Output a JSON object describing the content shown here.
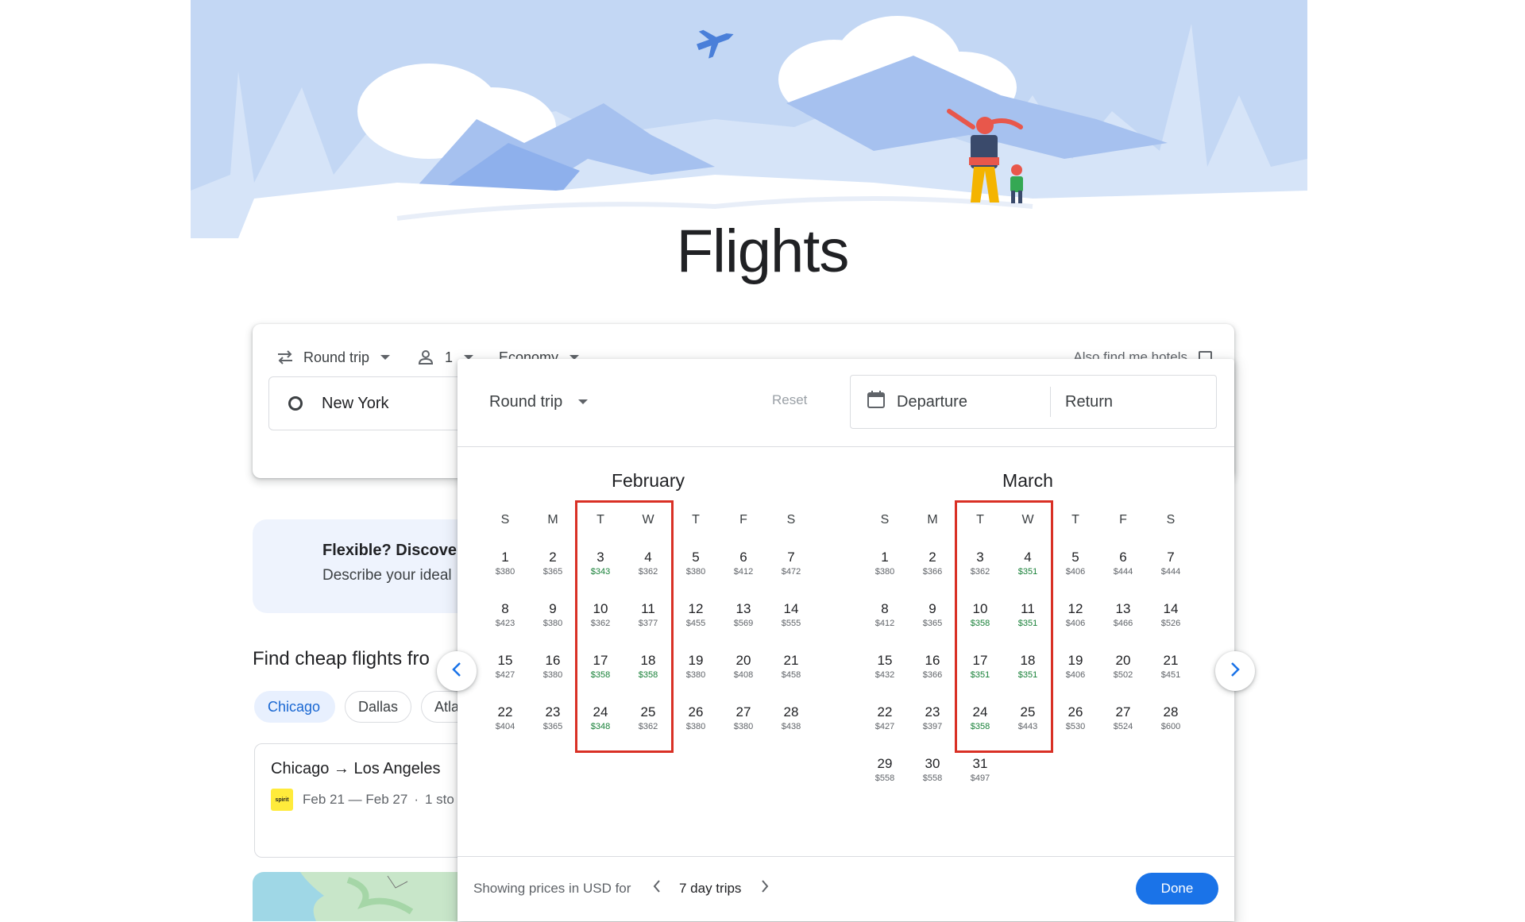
{
  "page": {
    "title": "Flights"
  },
  "search": {
    "trip_type": "Round trip",
    "passengers": "1",
    "cabin": "Economy",
    "hotels_label": "Also find me hotels",
    "origin": "New York"
  },
  "flexible": {
    "title": "Flexible? Discover",
    "subtitle": "Describe your ideal"
  },
  "cheap": {
    "heading": "Find cheap flights fro",
    "chips": [
      "Chicago",
      "Dallas",
      "Atla"
    ],
    "route": {
      "title": "Chicago → Los Angeles",
      "dates": "Feb 21 — Feb 27",
      "stops": "1 sto",
      "airline_logo": "spirit"
    }
  },
  "calendar": {
    "trip_type": "Round trip",
    "reset_label": "Reset",
    "departure_label": "Departure",
    "return_label": "Return",
    "weekdays": [
      "S",
      "M",
      "T",
      "W",
      "T",
      "F",
      "S"
    ],
    "months": [
      {
        "name": "February",
        "start_weekday": 0,
        "days": [
          {
            "d": "1",
            "p": "$380",
            "low": false
          },
          {
            "d": "2",
            "p": "$365",
            "low": false
          },
          {
            "d": "3",
            "p": "$343",
            "low": true
          },
          {
            "d": "4",
            "p": "$362",
            "low": false
          },
          {
            "d": "5",
            "p": "$380",
            "low": false
          },
          {
            "d": "6",
            "p": "$412",
            "low": false
          },
          {
            "d": "7",
            "p": "$472",
            "low": false
          },
          {
            "d": "8",
            "p": "$423",
            "low": false
          },
          {
            "d": "9",
            "p": "$380",
            "low": false
          },
          {
            "d": "10",
            "p": "$362",
            "low": false
          },
          {
            "d": "11",
            "p": "$377",
            "low": false
          },
          {
            "d": "12",
            "p": "$455",
            "low": false
          },
          {
            "d": "13",
            "p": "$569",
            "low": false
          },
          {
            "d": "14",
            "p": "$555",
            "low": false
          },
          {
            "d": "15",
            "p": "$427",
            "low": false
          },
          {
            "d": "16",
            "p": "$380",
            "low": false
          },
          {
            "d": "17",
            "p": "$358",
            "low": true
          },
          {
            "d": "18",
            "p": "$358",
            "low": true
          },
          {
            "d": "19",
            "p": "$380",
            "low": false
          },
          {
            "d": "20",
            "p": "$408",
            "low": false
          },
          {
            "d": "21",
            "p": "$458",
            "low": false
          },
          {
            "d": "22",
            "p": "$404",
            "low": false
          },
          {
            "d": "23",
            "p": "$365",
            "low": false
          },
          {
            "d": "24",
            "p": "$348",
            "low": true
          },
          {
            "d": "25",
            "p": "$362",
            "low": false
          },
          {
            "d": "26",
            "p": "$380",
            "low": false
          },
          {
            "d": "27",
            "p": "$380",
            "low": false
          },
          {
            "d": "28",
            "p": "$438",
            "low": false
          }
        ]
      },
      {
        "name": "March",
        "start_weekday": 0,
        "days": [
          {
            "d": "1",
            "p": "$380",
            "low": false
          },
          {
            "d": "2",
            "p": "$366",
            "low": false
          },
          {
            "d": "3",
            "p": "$362",
            "low": false
          },
          {
            "d": "4",
            "p": "$351",
            "low": true
          },
          {
            "d": "5",
            "p": "$406",
            "low": false
          },
          {
            "d": "6",
            "p": "$444",
            "low": false
          },
          {
            "d": "7",
            "p": "$444",
            "low": false
          },
          {
            "d": "8",
            "p": "$412",
            "low": false
          },
          {
            "d": "9",
            "p": "$365",
            "low": false
          },
          {
            "d": "10",
            "p": "$358",
            "low": true
          },
          {
            "d": "11",
            "p": "$351",
            "low": true
          },
          {
            "d": "12",
            "p": "$406",
            "low": false
          },
          {
            "d": "13",
            "p": "$466",
            "low": false
          },
          {
            "d": "14",
            "p": "$526",
            "low": false
          },
          {
            "d": "15",
            "p": "$432",
            "low": false
          },
          {
            "d": "16",
            "p": "$366",
            "low": false
          },
          {
            "d": "17",
            "p": "$351",
            "low": true
          },
          {
            "d": "18",
            "p": "$351",
            "low": true
          },
          {
            "d": "19",
            "p": "$406",
            "low": false
          },
          {
            "d": "20",
            "p": "$502",
            "low": false
          },
          {
            "d": "21",
            "p": "$451",
            "low": false
          },
          {
            "d": "22",
            "p": "$427",
            "low": false
          },
          {
            "d": "23",
            "p": "$397",
            "low": false
          },
          {
            "d": "24",
            "p": "$358",
            "low": true
          },
          {
            "d": "25",
            "p": "$443",
            "low": false
          },
          {
            "d": "26",
            "p": "$530",
            "low": false
          },
          {
            "d": "27",
            "p": "$524",
            "low": false
          },
          {
            "d": "28",
            "p": "$600",
            "low": false
          },
          {
            "d": "29",
            "p": "$558",
            "low": false
          },
          {
            "d": "30",
            "p": "$558",
            "low": false
          },
          {
            "d": "31",
            "p": "$497",
            "low": false
          }
        ]
      }
    ],
    "footer": {
      "showing_label": "Showing prices in USD for",
      "trip_length": "7 day trips",
      "done_label": "Done"
    }
  },
  "colors": {
    "accent": "#1a73e8",
    "low_price": "#188038",
    "highlight_box": "#d93025",
    "hero_sky": "#c6d9f5",
    "hero_mountain": "#a8c3f0"
  },
  "icons": {
    "swap": "swap-arrows-icon",
    "person": "person-icon",
    "calendar": "calendar-icon",
    "spark": "sparkle-icon",
    "chevron_left": "chevron-left-icon",
    "chevron_right": "chevron-right-icon"
  }
}
